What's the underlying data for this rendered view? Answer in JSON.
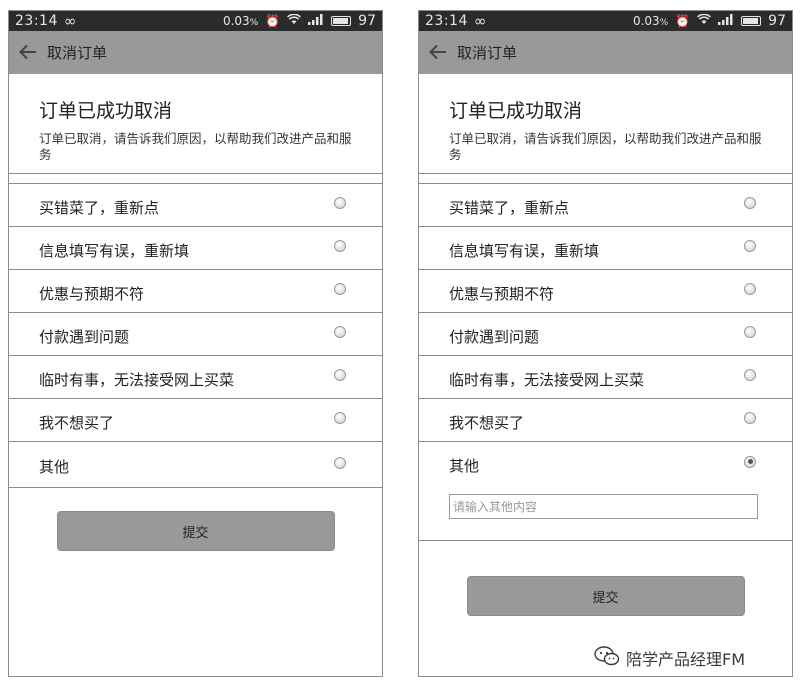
{
  "status_bar": {
    "time": "23:14",
    "infinity_glyph": "∞",
    "data_rate": "0.03",
    "data_unit": "%",
    "battery_level": "97"
  },
  "nav": {
    "title": "取消订单",
    "back_icon": "back-arrow-icon"
  },
  "header": {
    "title": "订单已成功取消",
    "subtitle": "订单已取消，请告诉我们原因，以帮助我们改进产品和服务"
  },
  "options": [
    {
      "label": "买错菜了，重新点"
    },
    {
      "label": "信息填写有误，重新填"
    },
    {
      "label": "优惠与预期不符"
    },
    {
      "label": "付款遇到问题"
    },
    {
      "label": "临时有事，无法接受网上买菜"
    },
    {
      "label": "我不想买了"
    },
    {
      "label": "其他"
    }
  ],
  "left_screen": {
    "selected_index": -1
  },
  "right_screen": {
    "selected_index": 6,
    "other_placeholder": "请输入其他内容"
  },
  "submit_label": "提交",
  "watermark": {
    "text": "陪学产品经理FM",
    "icon": "wechat-icon"
  },
  "colors": {
    "nav_bg": "#999999",
    "status_bg": "#2b2b2b",
    "button_bg": "#999999"
  }
}
